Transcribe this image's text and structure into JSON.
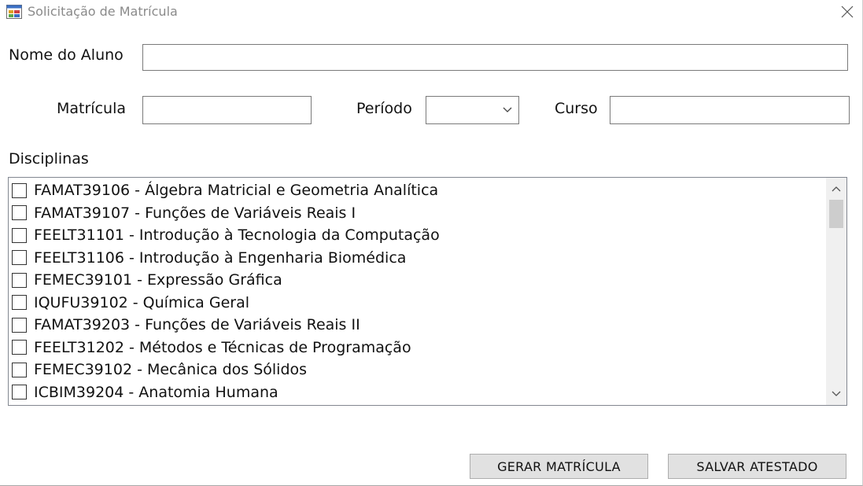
{
  "window": {
    "title": "Solicitação de Matrícula",
    "icon": "form-window-icon",
    "close_icon": "close-icon"
  },
  "form": {
    "nome_label": "Nome do Aluno",
    "nome_value": "",
    "matricula_label": "Matrícula",
    "matricula_value": "",
    "periodo_label": "Período",
    "periodo_selected": "",
    "curso_label": "Curso",
    "curso_value": "",
    "disciplinas_label": "Disciplinas"
  },
  "disciplinas": [
    {
      "label": "FAMAT39106 - Álgebra Matricial e Geometria Analítica",
      "checked": false
    },
    {
      "label": "FAMAT39107 - Funções de Variáveis Reais I",
      "checked": false
    },
    {
      "label": "FEELT31101 - Introdução à Tecnologia da Computação",
      "checked": false
    },
    {
      "label": "FEELT31106 - Introdução à Engenharia Biomédica",
      "checked": false
    },
    {
      "label": "FEMEC39101 - Expressão Gráfica",
      "checked": false
    },
    {
      "label": "IQUFU39102 - Química Geral",
      "checked": false
    },
    {
      "label": "FAMAT39203 - Funções de Variáveis Reais II",
      "checked": false
    },
    {
      "label": "FEELT31202 - Métodos e Técnicas de Programação",
      "checked": false
    },
    {
      "label": "FEMEC39102 - Mecânica dos Sólidos",
      "checked": false
    },
    {
      "label": "ICBIM39204 - Anatomia Humana",
      "checked": false
    }
  ],
  "buttons": {
    "gerar_label": "GERAR MATRÍCULA",
    "salvar_label": "SALVAR ATESTADO"
  }
}
